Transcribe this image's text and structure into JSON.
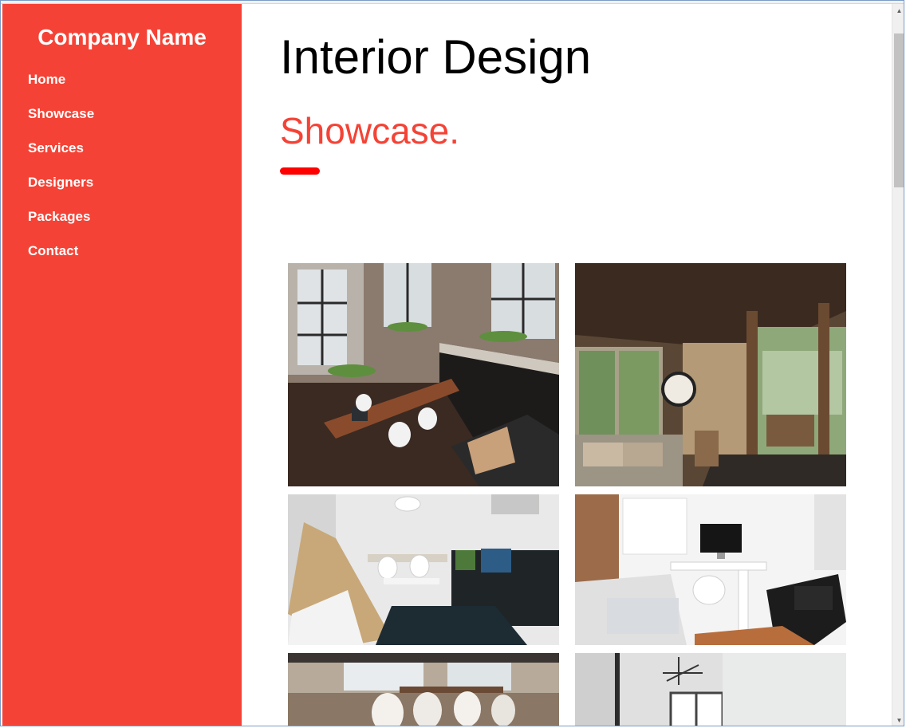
{
  "sidebar": {
    "brand": "Company Name",
    "items": [
      {
        "label": "Home"
      },
      {
        "label": "Showcase"
      },
      {
        "label": "Services"
      },
      {
        "label": "Designers"
      },
      {
        "label": "Packages"
      },
      {
        "label": "Contact"
      }
    ]
  },
  "main": {
    "title": "Interior Design",
    "subtitle": "Showcase."
  },
  "gallery": [
    {
      "name": "loft-kitchen-photo"
    },
    {
      "name": "porch-living-room-photo"
    },
    {
      "name": "modern-lounge-photo"
    },
    {
      "name": "bedroom-desk-photo"
    },
    {
      "name": "dining-room-photo"
    },
    {
      "name": "bright-room-photo"
    }
  ],
  "colors": {
    "sidebar": "#f44336",
    "accent": "#f44336",
    "bar": "#ff0000"
  },
  "scrollbar": {
    "up_icon": "▲",
    "down_icon": "▼"
  }
}
